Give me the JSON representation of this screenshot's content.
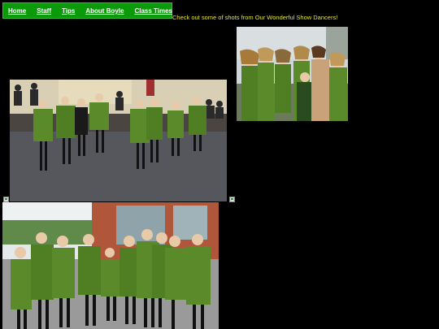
{
  "nav": {
    "items": [
      {
        "label": "Home"
      },
      {
        "label": "Staff"
      },
      {
        "label": "Tips"
      },
      {
        "label": "About Boyle"
      },
      {
        "label": "Class Times"
      }
    ]
  },
  "tagline": "Check out some of shots from Our Wonderful Show Dancers!",
  "colors": {
    "background": "#000000",
    "nav_background": "#0a9a0a",
    "nav_text": "#ffffff",
    "tagline_text": "#e6e633",
    "dress_green": "#5a8a2a"
  },
  "images": {
    "top_right": {
      "alt": "group of dancers posing outdoors"
    },
    "middle_left": {
      "alt": "dancers performing on stage"
    },
    "bottom_left": {
      "alt": "dancers posing in front of building"
    },
    "broken_left": {
      "alt": "broken image"
    },
    "broken_right": {
      "alt": "broken image"
    }
  }
}
